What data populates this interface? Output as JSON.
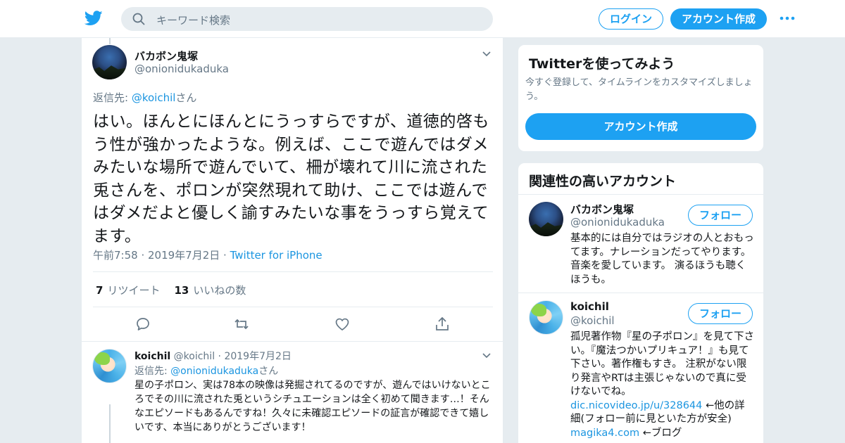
{
  "header": {
    "search_placeholder": "キーワード検索",
    "login_label": "ログイン",
    "signup_label": "アカウント作成"
  },
  "tweet": {
    "name": "バカボン鬼塚",
    "handle": "@onionidukaduka",
    "reply_prefix": "返信先: ",
    "reply_to": "@koichil",
    "reply_suffix": "さん",
    "text": "はい。ほんとにほんとにうっすらですが、道徳的啓もう性が強かったような。例えば、ここで遊んではダメみたいな場所で遊んでいて、柵が壊れて川に流された兎さんを、ポロンが突然現れて助け、ここでは遊んではダメだよと優しく諭すみたいな事をうっすら覚えてます。",
    "time": "午前7:58",
    "date": "2019年7月2日",
    "client": "Twitter for iPhone",
    "retweet_count": "7",
    "retweet_label": "リツイート",
    "like_count": "13",
    "like_label": "いいねの数"
  },
  "reply": {
    "name": "koichil",
    "handle": "@koichil",
    "date": "2019年7月2日",
    "reply_prefix": "返信先: ",
    "reply_to": "@onionidukaduka",
    "reply_suffix": "さん",
    "text": "星の子ポロン、実は78本の映像は発掘されてるのですが、遊んではいけないところでその川に流された兎というシチュエーションは全く初めて聞きます…！そんなエピソードもあるんですね！久々に未確認エピソードの証言が確認できて嬉しいです、本当にありがとうございます！"
  },
  "signup_card": {
    "title": "Twitterを使ってみよう",
    "subtitle": "今すぐ登録して、タイムラインをカスタマイズしましょう。",
    "button_label": "アカウント作成"
  },
  "related_card": {
    "title": "関連性の高いアカウント",
    "follow_label": "フォロー",
    "accounts": [
      {
        "name": "バカボン鬼塚",
        "handle": "@onionidukaduka",
        "bio": "基本的には自分ではラジオの人とおもってます。ナレーションだってやります。 音楽を愛しています。 演るほうも聴くほうも。"
      },
      {
        "name": "koichil",
        "handle": "@koichil",
        "bio": "孤児著作物『星の子ポロン』を見て下さい。『魔法つかいプリキュア！』も見て下さい。著作権もすき。 注釈がない限り発言やRTは主張じゃないので真に受けないでね。",
        "link1": "dic.nicovideo.jp/u/328644",
        "link1_note": " ←他の詳細(フォロー前に見といた方が安全)",
        "link2": "magika4.com",
        "link2_note": " ←ブログ"
      }
    ]
  },
  "colors": {
    "brand": "#1da1f2",
    "link": "#1b95e0",
    "muted": "#657786",
    "background": "#e6ecf0"
  },
  "icons": [
    "twitter-bird-icon",
    "search-icon",
    "more-icon",
    "chevron-down-icon",
    "reply-icon",
    "retweet-icon",
    "like-icon",
    "share-icon"
  ]
}
